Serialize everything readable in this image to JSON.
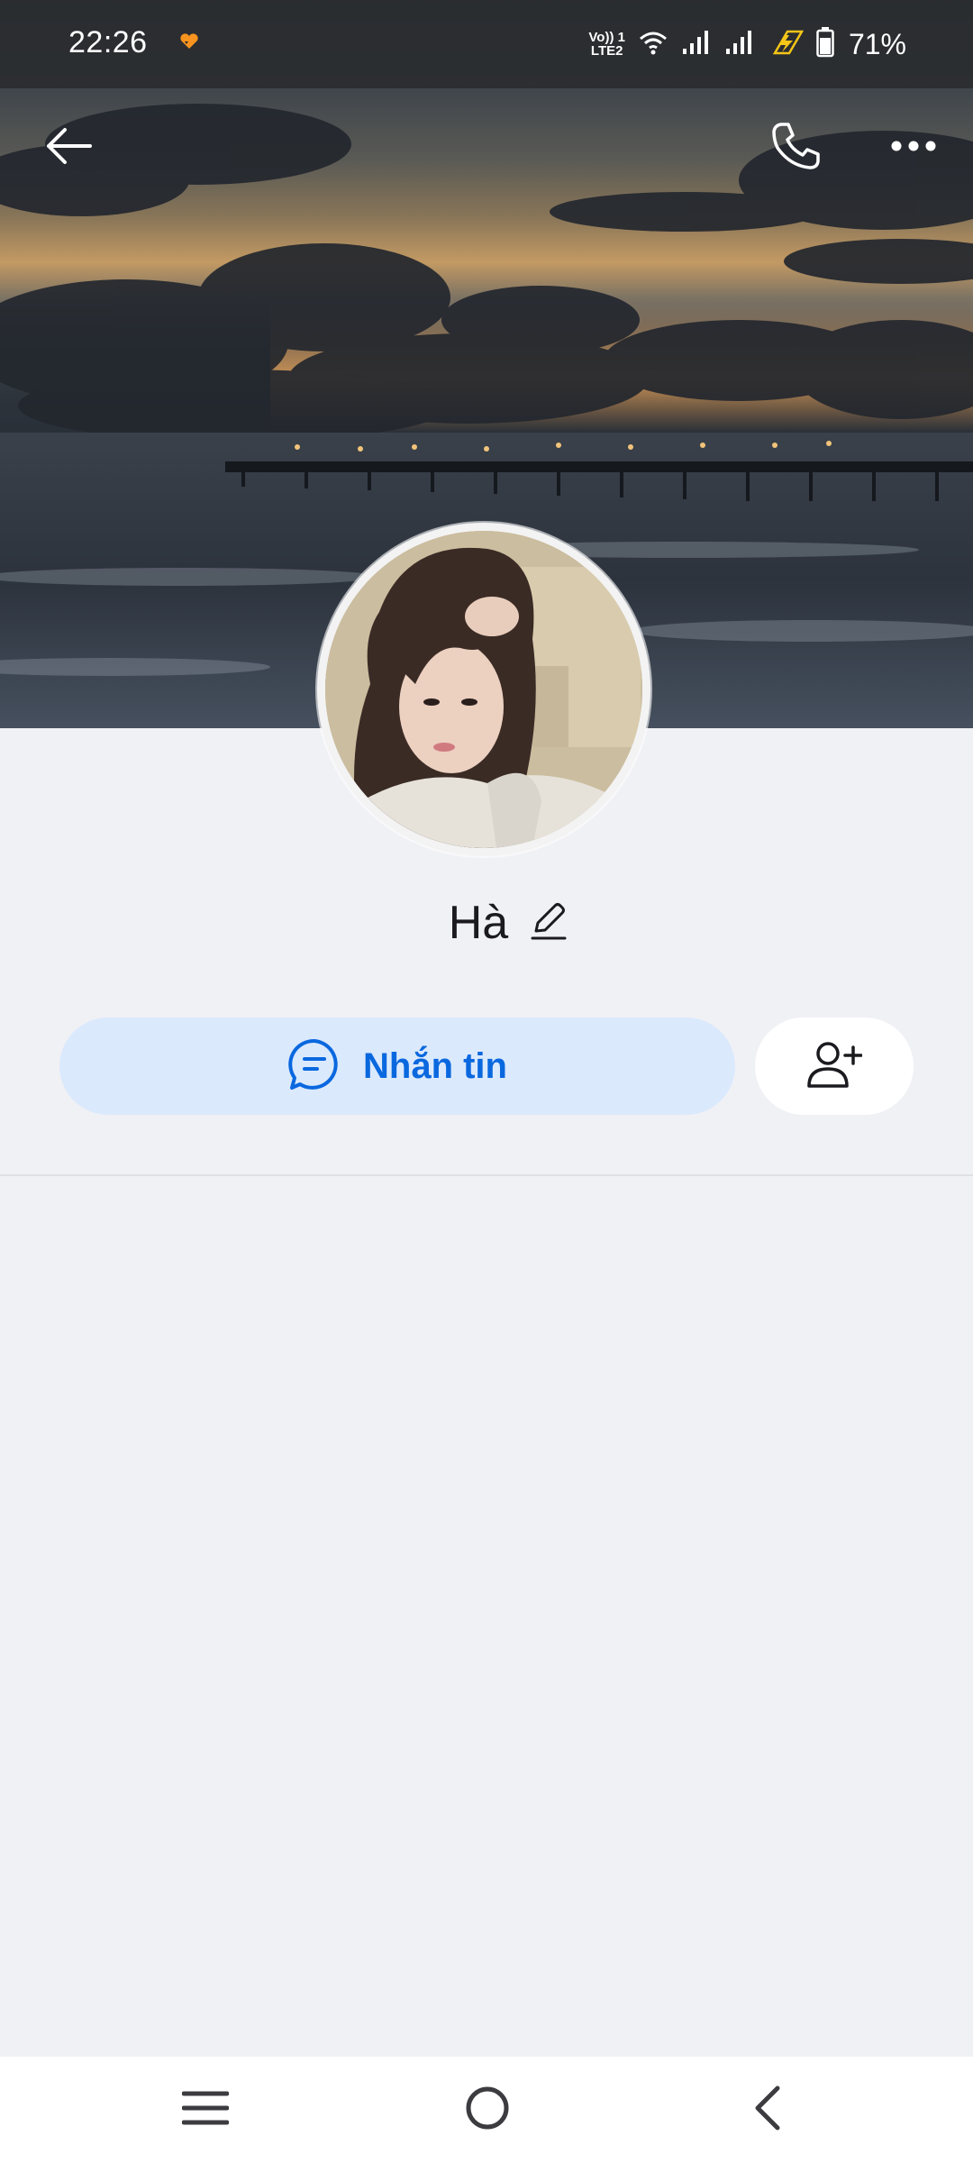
{
  "status_bar": {
    "time": "22:26",
    "volte_line1": "Vo)) 1",
    "volte_line2": "LTE2",
    "battery_percent": "71%",
    "icons": [
      "heart-notification-icon",
      "volte-icon",
      "wifi-icon",
      "signal-sim1-icon",
      "signal-sim2-icon",
      "charging-bolt-icon",
      "battery-icon"
    ]
  },
  "header": {
    "back_icon": "arrow-left-icon",
    "call_icon": "phone-icon",
    "more_icon": "more-horizontal-icon"
  },
  "profile": {
    "name": "Hà",
    "edit_icon": "pencil-icon"
  },
  "actions": {
    "message_label": "Nhắn tin",
    "message_icon": "chat-bubble-icon",
    "add_friend_icon": "add-user-icon"
  },
  "colors": {
    "accent": "#0a68df",
    "message_button_bg": "#dbe9fd",
    "page_bg": "#f0f1f5"
  },
  "nav_bar": {
    "icons": [
      "menu-icon",
      "home-icon",
      "back-chevron-icon"
    ]
  }
}
